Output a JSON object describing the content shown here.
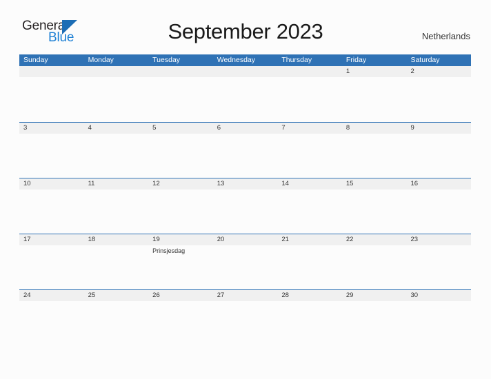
{
  "brand": {
    "name_part1": "General",
    "name_part2": "Blue",
    "color_dark": "#231f20",
    "color_blue": "#1c7fd4",
    "triangle_color": "#1c6db5"
  },
  "header": {
    "title": "September 2023",
    "region": "Netherlands"
  },
  "colors": {
    "header_row_bg": "#2f72b5",
    "day_strip_bg": "#f0f0f0",
    "week_divider": "#2f72b5",
    "page_bg": "#fcfcfc",
    "text": "#333333"
  },
  "weekdays": [
    "Sunday",
    "Monday",
    "Tuesday",
    "Wednesday",
    "Thursday",
    "Friday",
    "Saturday"
  ],
  "weeks": [
    {
      "days": [
        {
          "number": "",
          "event": ""
        },
        {
          "number": "",
          "event": ""
        },
        {
          "number": "",
          "event": ""
        },
        {
          "number": "",
          "event": ""
        },
        {
          "number": "",
          "event": ""
        },
        {
          "number": "1",
          "event": ""
        },
        {
          "number": "2",
          "event": ""
        }
      ]
    },
    {
      "days": [
        {
          "number": "3",
          "event": ""
        },
        {
          "number": "4",
          "event": ""
        },
        {
          "number": "5",
          "event": ""
        },
        {
          "number": "6",
          "event": ""
        },
        {
          "number": "7",
          "event": ""
        },
        {
          "number": "8",
          "event": ""
        },
        {
          "number": "9",
          "event": ""
        }
      ]
    },
    {
      "days": [
        {
          "number": "10",
          "event": ""
        },
        {
          "number": "11",
          "event": ""
        },
        {
          "number": "12",
          "event": ""
        },
        {
          "number": "13",
          "event": ""
        },
        {
          "number": "14",
          "event": ""
        },
        {
          "number": "15",
          "event": ""
        },
        {
          "number": "16",
          "event": ""
        }
      ]
    },
    {
      "days": [
        {
          "number": "17",
          "event": ""
        },
        {
          "number": "18",
          "event": ""
        },
        {
          "number": "19",
          "event": "Prinsjesdag"
        },
        {
          "number": "20",
          "event": ""
        },
        {
          "number": "21",
          "event": ""
        },
        {
          "number": "22",
          "event": ""
        },
        {
          "number": "23",
          "event": ""
        }
      ]
    },
    {
      "days": [
        {
          "number": "24",
          "event": ""
        },
        {
          "number": "25",
          "event": ""
        },
        {
          "number": "26",
          "event": ""
        },
        {
          "number": "27",
          "event": ""
        },
        {
          "number": "28",
          "event": ""
        },
        {
          "number": "29",
          "event": ""
        },
        {
          "number": "30",
          "event": ""
        }
      ]
    }
  ]
}
